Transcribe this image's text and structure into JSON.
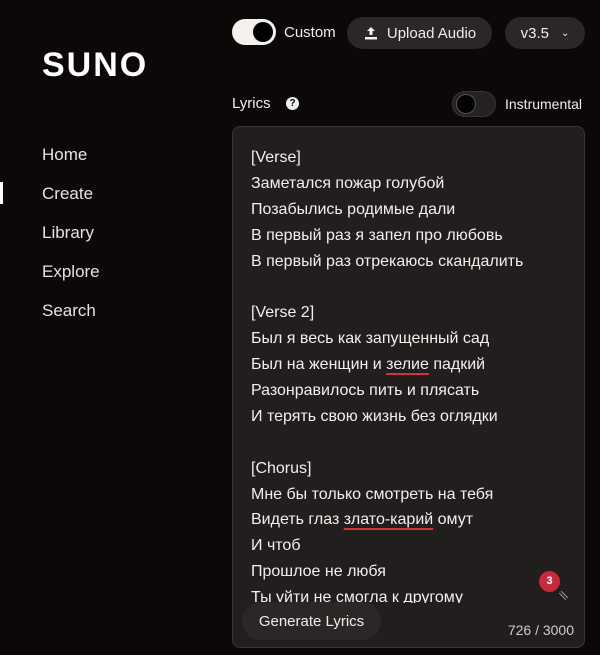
{
  "logo": "SUNO",
  "nav": {
    "items": [
      {
        "label": "Home"
      },
      {
        "label": "Create",
        "active": true
      },
      {
        "label": "Library"
      },
      {
        "label": "Explore"
      },
      {
        "label": "Search"
      }
    ]
  },
  "toolbar": {
    "custom_label": "Custom",
    "custom_on": true,
    "upload_label": "Upload Audio",
    "upload_icon": "upload-icon",
    "version": "v3.5"
  },
  "lyrics": {
    "label": "Lyrics",
    "instrumental_label": "Instrumental",
    "instrumental_on": false,
    "lines": [
      [
        "[Verse]"
      ],
      [
        "Заметался пожар голубой"
      ],
      [
        "Позабылись родимые дали"
      ],
      [
        "В первый раз я запел про любовь"
      ],
      [
        "В первый раз отрекаюсь скандалить"
      ],
      [
        ""
      ],
      [
        "[Verse 2]"
      ],
      [
        "Был я весь как запущенный сад"
      ],
      [
        "Был на женщин и ",
        "зелие",
        " падкий"
      ],
      [
        "Разонравилось пить и плясать"
      ],
      [
        "И терять свою жизнь без оглядки"
      ],
      [
        ""
      ],
      [
        "[Chorus]"
      ],
      [
        "Мне бы только смотреть на тебя"
      ],
      [
        "Видеть глаз ",
        "злато-карий",
        " омут"
      ],
      [
        "И чтоб"
      ],
      [
        "Прошлое не любя"
      ],
      [
        "Ты уйти не смогла к другому"
      ]
    ],
    "badge": "3",
    "generate_label": "Generate Lyrics",
    "count": "726 / 3000"
  },
  "colors": {
    "background": "#0c0808",
    "panel": "#221e1d",
    "accent": "#c7293e"
  }
}
